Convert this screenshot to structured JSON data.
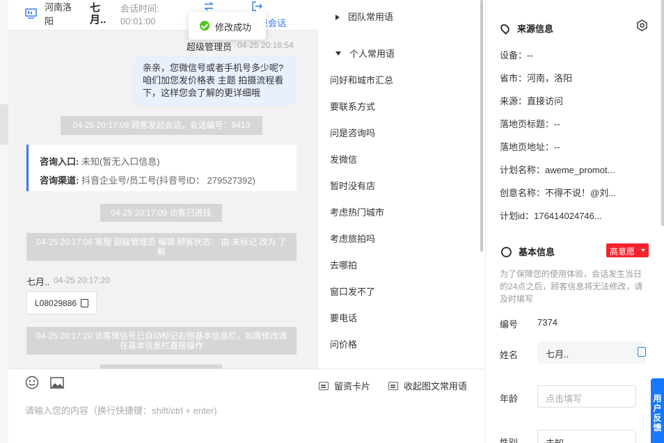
{
  "header": {
    "location": "河南洛阳",
    "customer_name": "七月..",
    "session_time_label": "会话时间:",
    "session_time": "00:01:00",
    "end_session_label": "束会话"
  },
  "toast": {
    "text": "修改成功"
  },
  "messages": {
    "agent_sender": "超级管理员",
    "agent_time": "04-25 20:16:54",
    "agent_text": "亲亲，您微信号或者手机号多少呢?咱们加您发价格表 主题 拍摄流程看下，这样您会了解的更详细哦",
    "sys_start": "04-25 20:17:09 顾客发起会话，会话编号：9413",
    "entry_label": "咨询入口:",
    "entry_value": "未知(暂无入口信息)",
    "channel_label": "咨询渠道:",
    "channel_value": "抖音企业号/员工号(抖音号ID： 279527392)",
    "sys_enter": "04-25 20:17:09 访客已进线",
    "sys_edit": "04-25 20:17:06 客服 超级管理员 编辑 顾客状态： 由 未标记 改为 了解",
    "customer_name": "七月..",
    "customer_time": "04-25 20:17:20",
    "customer_code": "L08029886",
    "sys_auto": "04-25 20:17:20 访客微信号已自动标记右侧基本信息栏，如需修改请在基本信息栏直接操作"
  },
  "input": {
    "card_label": "留资卡片",
    "collapse_label": "收起图文常用语",
    "placeholder": "请输入您的内容（换行快捷键：shift/ctrl + enter)"
  },
  "phrases": {
    "team_group": "团队常用语",
    "personal_group": "个人常用语",
    "items": [
      "问好和城市汇总",
      "要联系方式",
      "问是咨询吗",
      "发微信",
      "暂时没有店",
      "考虑热门城市",
      "考虑旅拍吗",
      "去哪拍",
      "窗口发不了",
      "要电话",
      "问价格"
    ]
  },
  "source": {
    "title": "来源信息",
    "rows": [
      "设备：--",
      "省市：河南，洛阳",
      "来源：直接访问",
      "落地页标题：--",
      "落地页地址：--",
      "计划名称：aweme_promot...",
      "创意名称：不得不说！@刘...",
      "计划id：176414024746..."
    ]
  },
  "basic": {
    "title": "基本信息",
    "badge": "高意愿",
    "note": "为了保障您的使用体验，会话发生当日的24点之后，顾客信息将无法修改，请及时填写",
    "id_label": "编号",
    "id_value": "7374",
    "name_label": "姓名",
    "name_value": "七月..",
    "age_label": "年龄",
    "age_placeholder": "点击填写",
    "gender_label": "性别",
    "gender_value": "未知"
  },
  "feedback": {
    "label": "用户反馈"
  },
  "colors": {
    "accent": "#3478f6",
    "badge": "#f5222d",
    "success": "#52c41a"
  }
}
